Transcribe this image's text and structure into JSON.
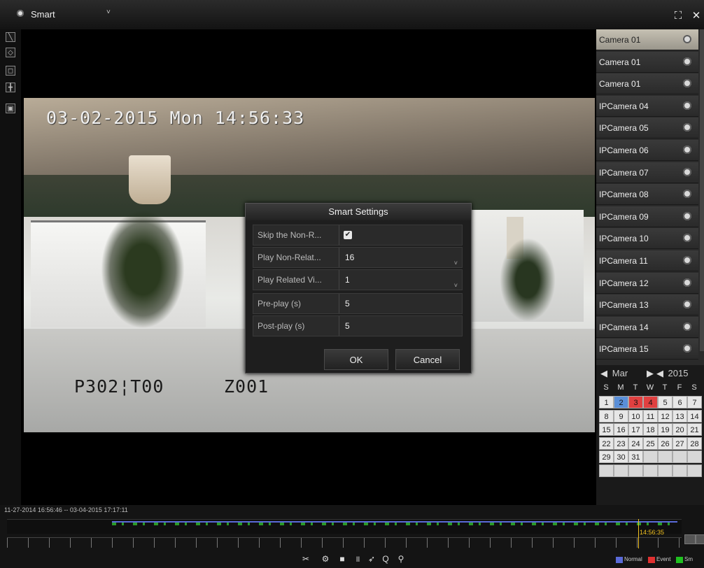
{
  "topbar": {
    "mode": "Smart",
    "mode_caret": "˅",
    "buttons": [
      {
        "name": "fullscreen-icon",
        "glyph": "⛶"
      },
      {
        "name": "close-icon",
        "glyph": "✕"
      }
    ]
  },
  "video": {
    "timestamp": "03-02-2015 Mon 14:56:33",
    "osd_left": "P302¦T00",
    "osd_right": "Z001"
  },
  "dialog": {
    "title": "Smart Settings",
    "rows": [
      {
        "label": "Skip the Non-R...",
        "value": "",
        "checked": true,
        "type": "checkbox"
      },
      {
        "label": "Play Non-Relat...",
        "value": "16",
        "type": "select"
      },
      {
        "label": "Play Related Vi...",
        "value": "1",
        "type": "select"
      },
      {
        "label": "Pre-play (s)",
        "value": "5",
        "type": "text"
      },
      {
        "label": "Post-play (s)",
        "value": "5",
        "type": "text"
      }
    ],
    "ok_label": "OK",
    "cancel_label": "Cancel",
    "caret": "˅",
    "check_glyph": "✔"
  },
  "cameras": [
    {
      "name": "Camera 01",
      "selected": true
    },
    {
      "name": "Camera 01"
    },
    {
      "name": "Camera 01"
    },
    {
      "name": "IPCamera 04"
    },
    {
      "name": "IPCamera 05"
    },
    {
      "name": "IPCamera 06"
    },
    {
      "name": "IPCamera 07"
    },
    {
      "name": "IPCamera 08"
    },
    {
      "name": "IPCamera 09"
    },
    {
      "name": "IPCamera 10"
    },
    {
      "name": "IPCamera 11"
    },
    {
      "name": "IPCamera 12"
    },
    {
      "name": "IPCamera 13"
    },
    {
      "name": "IPCamera 14"
    },
    {
      "name": "IPCamera 15"
    }
  ],
  "calendar": {
    "month": "Mar",
    "year": "2015",
    "weekdays": [
      "S",
      "M",
      "T",
      "W",
      "T",
      "F",
      "S"
    ],
    "weeks": [
      [
        "1",
        "2",
        "3",
        "4",
        "5",
        "6",
        "7"
      ],
      [
        "8",
        "9",
        "10",
        "11",
        "12",
        "13",
        "14"
      ],
      [
        "15",
        "16",
        "17",
        "18",
        "19",
        "20",
        "21"
      ],
      [
        "22",
        "23",
        "24",
        "25",
        "26",
        "27",
        "28"
      ],
      [
        "29",
        "30",
        "31",
        "",
        "",
        "",
        ""
      ],
      [
        "",
        "",
        "",
        "",
        "",
        "",
        ""
      ]
    ],
    "normal_days": [
      "2"
    ],
    "event_days": [
      "3",
      "4"
    ],
    "colors": {
      "normal": "#5a8fd8",
      "event": "#e04040"
    }
  },
  "timeline": {
    "range": "11-27-2014 16:56:46 -- 03-04-2015 17:17:11",
    "current_time": "14:56:35",
    "controls": [
      {
        "name": "cut-icon",
        "glyph": "✂"
      },
      {
        "name": "lock-icon",
        "glyph": "⚙"
      },
      {
        "name": "stop-icon",
        "glyph": "■"
      },
      {
        "name": "pause-icon",
        "glyph": "॥"
      },
      {
        "name": "play-icon",
        "glyph": "➶"
      },
      {
        "name": "zoom-icon",
        "glyph": "Q"
      },
      {
        "name": "filter-icon",
        "glyph": "⚲"
      }
    ],
    "legend": [
      {
        "label": "Normal",
        "color": "#5a6ad8"
      },
      {
        "label": "Event",
        "color": "#e03030"
      },
      {
        "label": "Sm",
        "color": "#20c020"
      }
    ]
  }
}
